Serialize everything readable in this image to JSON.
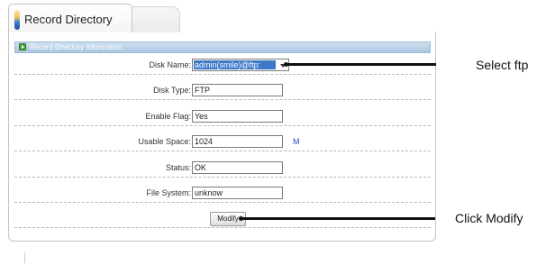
{
  "tab": {
    "title": "Record Directory"
  },
  "section": {
    "title": "Record Directory Information"
  },
  "form": {
    "disk_name": {
      "label": "Disk Name:",
      "value": "admin(smile)@ftp:"
    },
    "disk_type": {
      "label": "Disk Type:",
      "value": "FTP"
    },
    "enable_flag": {
      "label": "Enable Flag:",
      "value": "Yes"
    },
    "usable_space": {
      "label": "Usable Space:",
      "value": "1024",
      "unit": "M"
    },
    "status": {
      "label": "Status:",
      "value": "OK"
    },
    "file_system": {
      "label": "File System:",
      "value": "unknow"
    },
    "modify_label": "Modify"
  },
  "callouts": {
    "select_ftp": "Select ftp",
    "click_modify": "Click Modify"
  },
  "colors": {
    "section_bar": "#a9c6e1",
    "selection": "#3c78c8",
    "unit": "#2b48c2"
  },
  "icons": {
    "tab": "record-directory-icon",
    "section": "section-arrow-icon",
    "dropdown": "chevron-down-icon"
  }
}
